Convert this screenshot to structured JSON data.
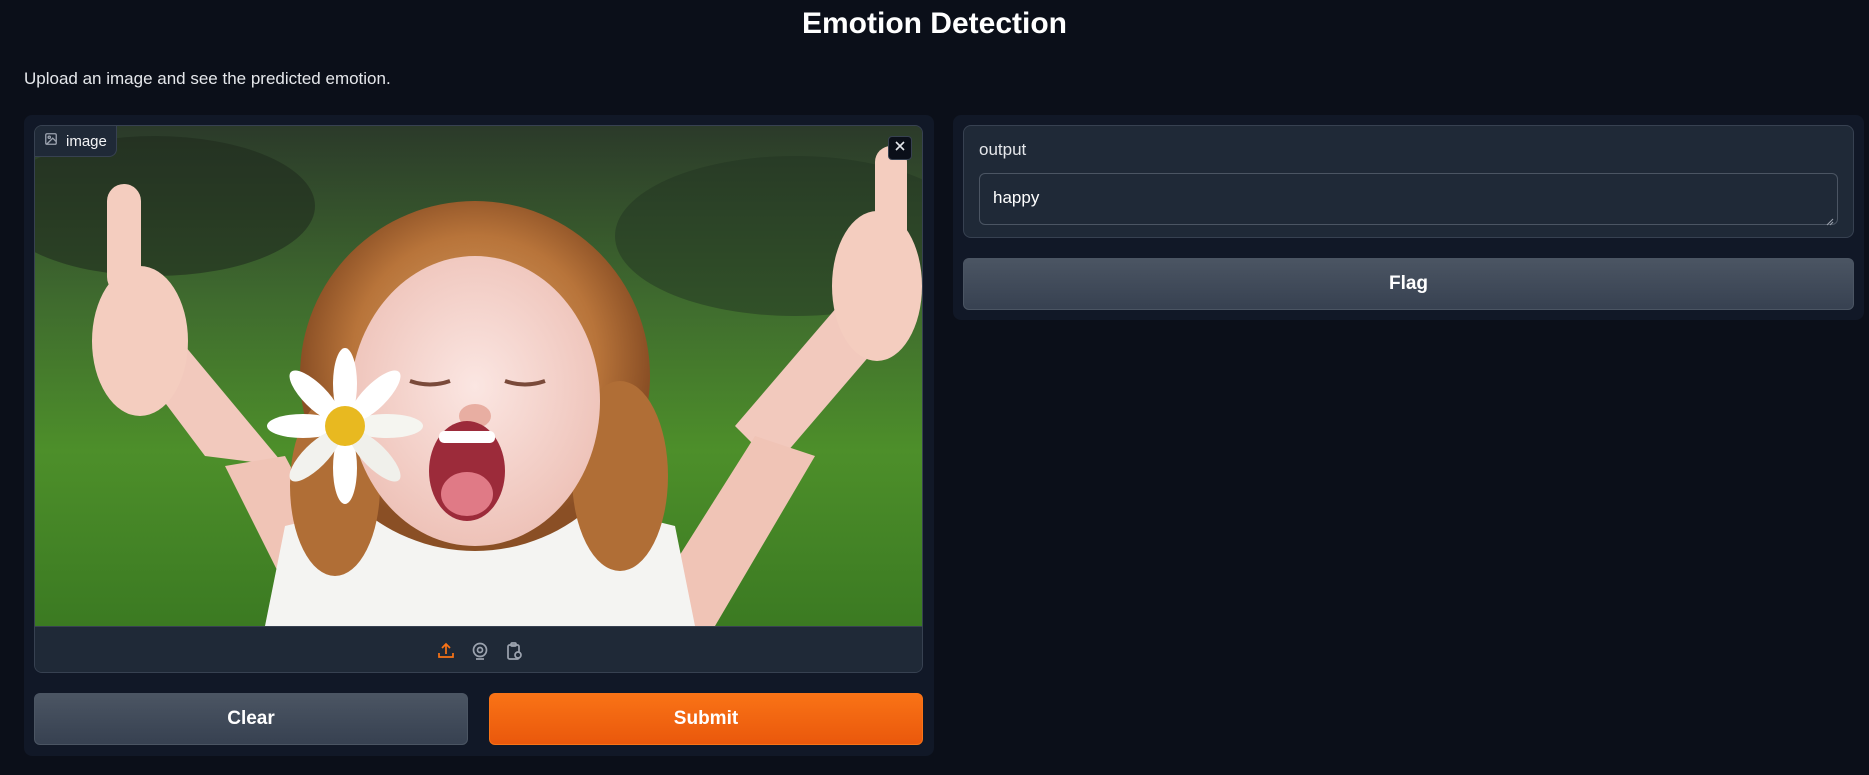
{
  "header": {
    "title": "Emotion Detection",
    "description": "Upload an image and see the predicted emotion."
  },
  "input_panel": {
    "image_label": "image",
    "image_icon": "image-icon",
    "close_icon": "close-icon",
    "sources": [
      {
        "name": "upload-icon",
        "active": true
      },
      {
        "name": "webcam-icon",
        "active": false
      },
      {
        "name": "clipboard-icon",
        "active": false
      }
    ],
    "clear_label": "Clear",
    "submit_label": "Submit"
  },
  "output_panel": {
    "label": "output",
    "value": "happy",
    "flag_label": "Flag"
  },
  "colors": {
    "background": "#0b0f19",
    "panel": "#111827",
    "block": "#1f2937",
    "accent": "#f97316",
    "secondary_button": "#4b5563"
  }
}
